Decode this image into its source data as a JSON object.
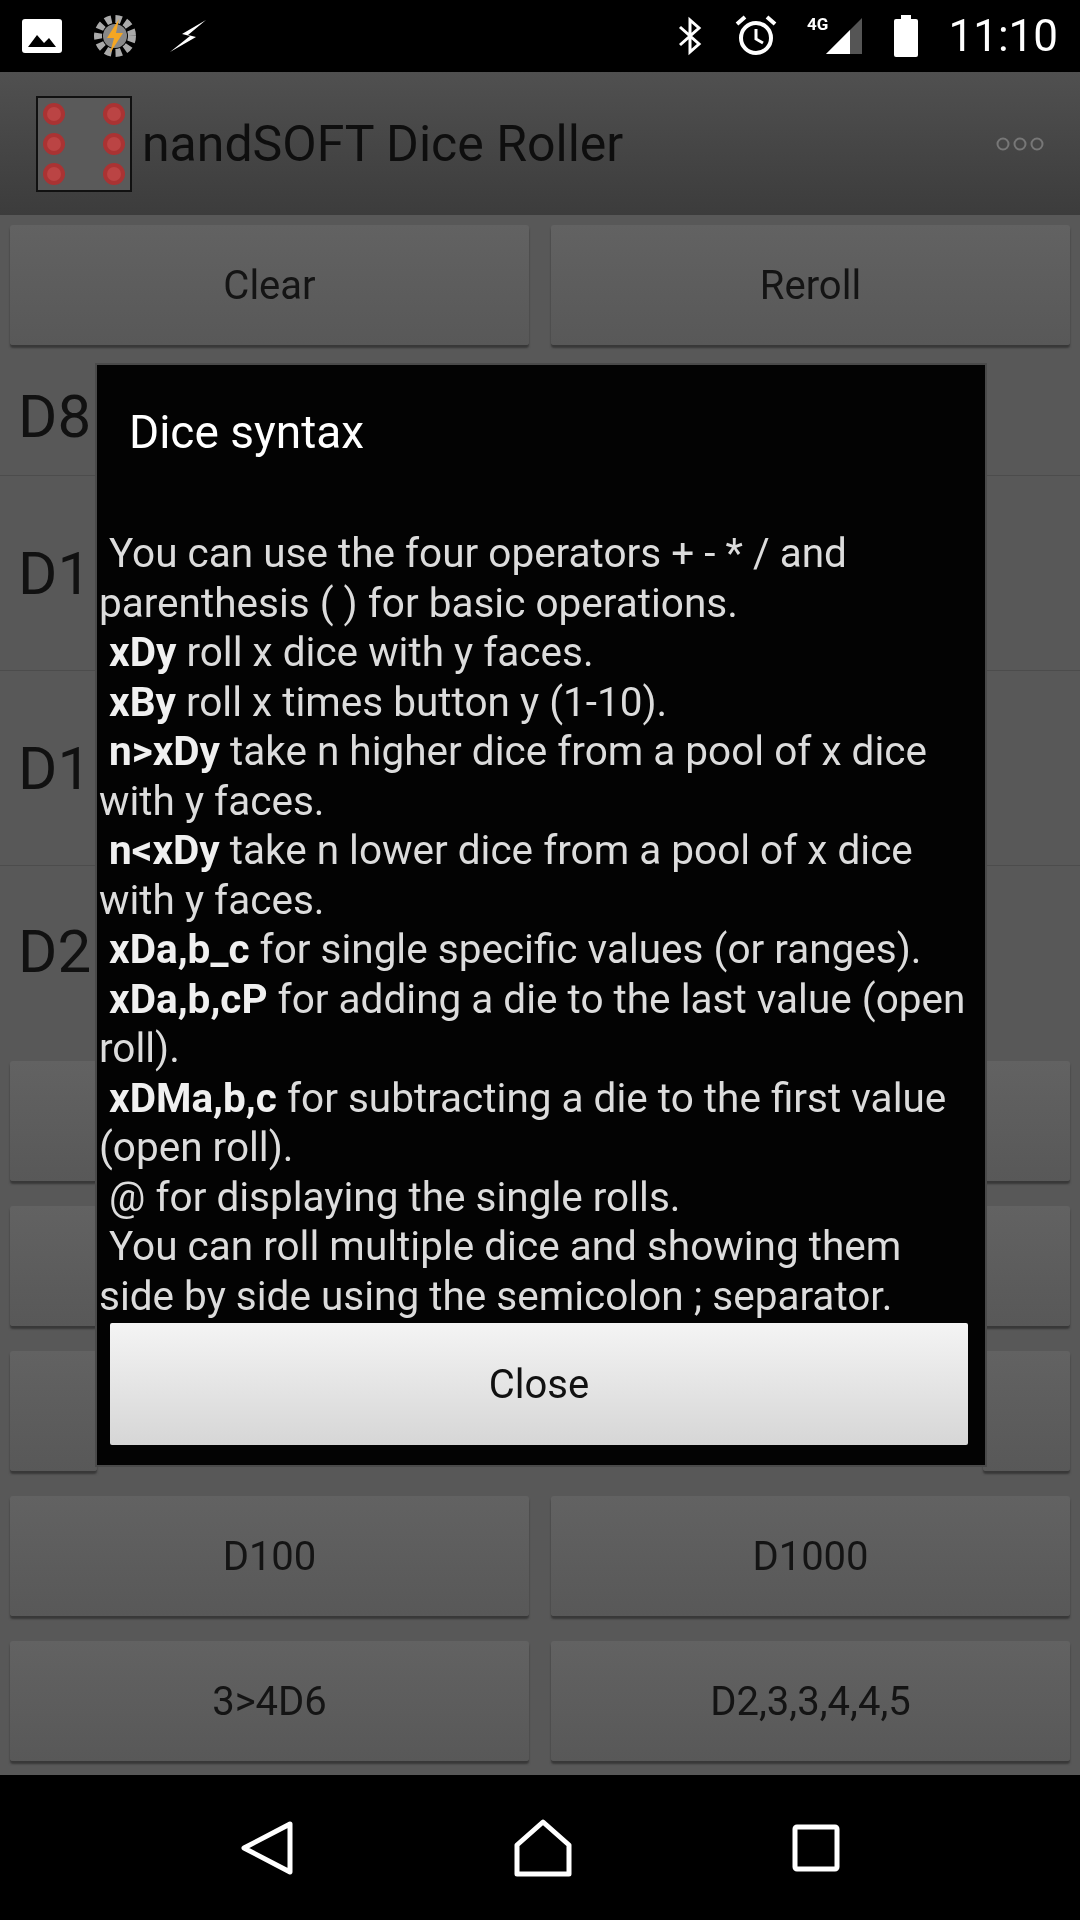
{
  "status_bar": {
    "network": "4G",
    "time": "11:10"
  },
  "app_bar": {
    "title": "nandSOFT Dice Roller"
  },
  "top_buttons": [
    "Clear",
    "Reroll"
  ],
  "results": [
    "D8",
    "D1",
    "D1",
    "D2"
  ],
  "dice_buttons": [
    {
      "left": "D100",
      "right": "D1000"
    },
    {
      "left": "3>4D6",
      "right": "D2,3,3,4,4,5"
    }
  ],
  "dialog": {
    "title": "Dice syntax",
    "body": " You can use the four operators + - * / and parenthesis ( ) for basic operations.\n **xDy** roll x dice with y faces.\n **xBy** roll x times button y (1-10).\n **n>xDy** take n higher dice from a pool of x dice with y faces.\n **n<xDy** take n lower dice from a pool of x dice with y faces.\n **xDa,b_c** for single specific values (or ranges).\n **xDa,b,cP** for adding a die to the last value (open roll).\n **xDMa,b,c** for subtracting a die to the first value (open roll).\n @ for displaying the single rolls.\n You can roll multiple dice and showing them side by side using the semicolon ; separator.",
    "button": "Close"
  }
}
